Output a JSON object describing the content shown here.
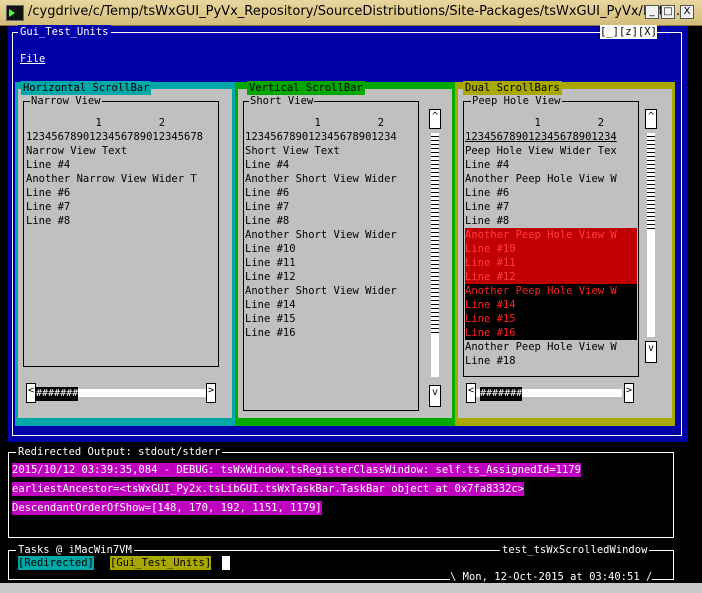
{
  "window": {
    "title": "/cygdrive/c/Temp/tsWxGUI_PyVx_Repository/SourceDistributions/Site-Packages/tsWxGUI_PyVx/Pyth...",
    "min": "_",
    "max": "□",
    "close": "X"
  },
  "app": {
    "title": "Gui_Test_Units",
    "controls": "[_][z][X]",
    "menu_file": "File"
  },
  "panels": {
    "horizontal": {
      "title": "Horizontal ScrollBar",
      "view_title": "Narrow View",
      "lines": [
        "           1         2",
        "1234567890123456789012345678",
        "Narrow View Text",
        "Line #4",
        "Another Narrow View Wider T",
        "Line #6",
        "Line #7",
        "Line #8"
      ],
      "left_arrow": "<",
      "right_arrow": ">",
      "thumb": "#######"
    },
    "vertical": {
      "title": "Vertical ScrollBar",
      "view_title": "Short View",
      "lines": [
        "           1         2",
        "123456789012345678901234",
        "Short View Text",
        "Line #4",
        "Another Short View Wider",
        "Line #6",
        "Line #7",
        "Line #8",
        "Another Short View Wider",
        "Line #10",
        "Line #11",
        "Line #12",
        "Another Short View Wider",
        "Line #14",
        "Line #15",
        "Line #16"
      ],
      "up_arrow": "^",
      "down_arrow": "v"
    },
    "dual": {
      "title": "Dual ScrollBars",
      "view_title": "Peep Hole View",
      "lines": [
        "           1         2",
        "123456789012345678901234",
        "Peep Hole View Wider Tex",
        "Line #4",
        "Another Peep Hole View W",
        "Line #6",
        "Line #7",
        "Line #8",
        "Another Peep Hole View W",
        "Line #10",
        "Line #11",
        "Line #12",
        "Another Peep Hole View W",
        "Line #14",
        "Line #15",
        "Line #16",
        "Another Peep Hole View W",
        "Line #18"
      ],
      "up_arrow": "^",
      "down_arrow": "v",
      "left_arrow": "<",
      "right_arrow": ">",
      "thumb": "#######"
    }
  },
  "output": {
    "title": "Redirected Output: stdout/stderr",
    "lines": [
      "2015/10/12 03:39:35,084 - DEBUG: tsWxWindow.tsRegisterClassWindow: self.ts_AssignedId=1179",
      "earliestAncestor=<tsWxGUI_Py2x.tsLibGUI.tsWxTaskBar.TaskBar object at 0x7fa8332c>",
      "DescendantOrderOfShow=[148, 170, 192, 1151, 1179]"
    ]
  },
  "taskbar": {
    "title": "Tasks @ iMacWin7VM",
    "app_name": "test_tsWxScrolledWindow",
    "btn_redirected": "[Redirected]",
    "btn_gui": "[Gui_Test_Units]",
    "datetime": "\\ Mon, 12-Oct-2015 at 03:40:51 /"
  },
  "colors": {
    "desktop_blue": "#0000a8",
    "horizontal_panel": "#00a8a8",
    "vertical_panel": "#00a800",
    "dual_panel": "#a8a800",
    "output_highlight": "#c000c0"
  }
}
